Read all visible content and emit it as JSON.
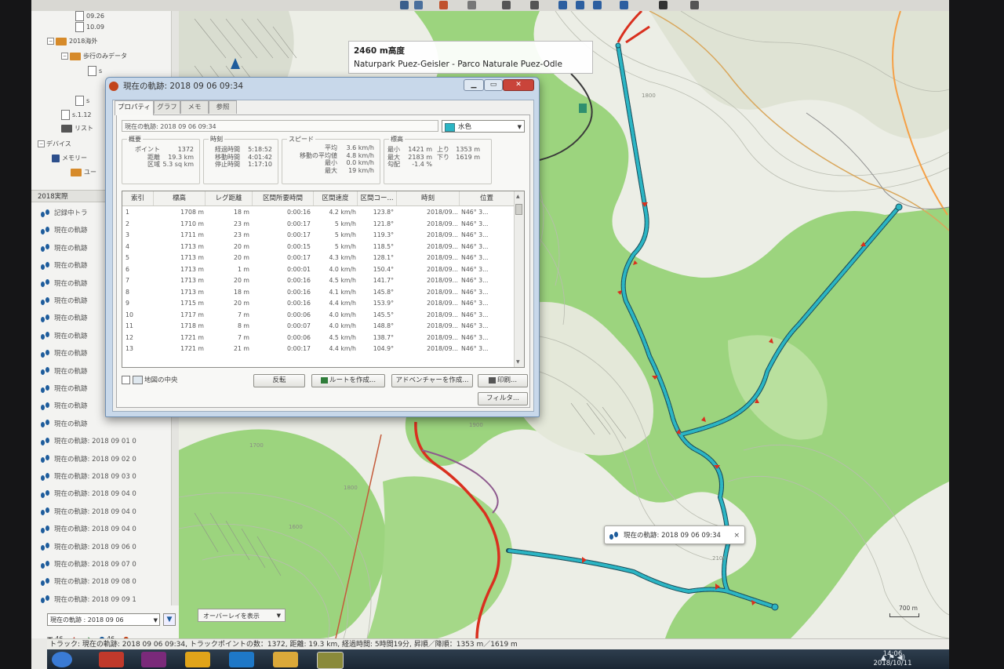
{
  "window": {
    "dialog_title": "現在の軌跡: 2018 09 06 09:34",
    "tabs": [
      "プロパティ",
      "グラフ",
      "メモ",
      "参照"
    ]
  },
  "sidebar": {
    "tree": [
      {
        "label": "09.26"
      },
      {
        "label": "10.09"
      },
      {
        "label": "2018海外"
      },
      {
        "label": "歩行のみデータ"
      },
      {
        "label": "s"
      },
      {
        "label": "s"
      },
      {
        "label": "s.1.12"
      },
      {
        "label": "リスト"
      },
      {
        "label": "デバイス"
      },
      {
        "label": "メモリー"
      },
      {
        "label": "ユー"
      }
    ],
    "section_title": "2018実際",
    "tracks": [
      {
        "label": "記録中トラ"
      },
      {
        "label": "現在の軌跡"
      },
      {
        "label": "現在の軌跡"
      },
      {
        "label": "現在の軌跡"
      },
      {
        "label": "現在の軌跡"
      },
      {
        "label": "現在の軌跡"
      },
      {
        "label": "現在の軌跡"
      },
      {
        "label": "現在の軌跡"
      },
      {
        "label": "現在の軌跡"
      },
      {
        "label": "現在の軌跡"
      },
      {
        "label": "現在の軌跡"
      },
      {
        "label": "現在の軌跡"
      },
      {
        "label": "現在の軌跡"
      },
      {
        "label": "現在の軌跡: 2018 09 01 0"
      },
      {
        "label": "現在の軌跡: 2018 09 02 0"
      },
      {
        "label": "現在の軌跡: 2018 09 03 0"
      },
      {
        "label": "現在の軌跡: 2018 09 04 0"
      },
      {
        "label": "現在の軌跡: 2018 09 04 0"
      },
      {
        "label": "現在の軌跡: 2018 09 04 0"
      },
      {
        "label": "現在の軌跡: 2018 09 06 0"
      },
      {
        "label": "現在の軌跡: 2018 09 07 0"
      },
      {
        "label": "現在の軌跡: 2018 09 08 0"
      },
      {
        "label": "現在の軌跡: 2018 09 09 1"
      }
    ],
    "selected_track": "現在の軌跡 : 2018 09 06",
    "bottom_count_a": "46",
    "bottom_count_b": "46"
  },
  "map": {
    "tooltip_altitude": "2460 m高度",
    "tooltip_name": "Naturpark Puez-Geisler - Parco Naturale Puez-Odle",
    "overlay_button": "オーバーレイを表示",
    "popup_label": "現在の軌跡: 2018 09 06 09:34",
    "popup_close": "×",
    "scale_label": "700 m",
    "contour_labels": [
      "1700",
      "1800",
      "1900",
      "1600",
      "2100",
      "1800"
    ]
  },
  "properties": {
    "name_value": "現在の軌跡: 2018 09 06 09:34",
    "color_value": "水色",
    "summary": {
      "title": "概要",
      "rows": [
        {
          "k": "ポイント",
          "v": "1372"
        },
        {
          "k": "距離",
          "v": "19.3 km"
        },
        {
          "k": "区域",
          "v": "5.3 sq km"
        }
      ]
    },
    "time": {
      "title": "時刻",
      "rows": [
        {
          "k": "経過時間",
          "v": "5:18:52"
        },
        {
          "k": "移動時間",
          "v": "4:01:42"
        },
        {
          "k": "停止時間",
          "v": "1:17:10"
        }
      ]
    },
    "speed": {
      "title": "スピード",
      "rows": [
        {
          "k": "平均",
          "v": "3.6 km/h"
        },
        {
          "k": "移動の平均値",
          "v": "4.8 km/h"
        },
        {
          "k": "最小",
          "v": "0.0 km/h"
        },
        {
          "k": "最大",
          "v": "19 km/h"
        }
      ]
    },
    "elevation": {
      "title": "標高",
      "rows": [
        {
          "k": "最小",
          "v": "1421 m",
          "k2": "上り",
          "v2": "1353 m"
        },
        {
          "k": "最大",
          "v": "2183 m",
          "k2": "下り",
          "v2": "1619 m"
        },
        {
          "k": "勾配",
          "v": "-1.4 %",
          "k2": "",
          "v2": ""
        }
      ]
    },
    "table": {
      "headers": [
        "索引",
        "標高",
        "レグ距離",
        "区間所要時間",
        "区間速度",
        "区間コー...",
        "時刻",
        "位置"
      ],
      "rows": [
        [
          "1",
          "1708 m",
          "18 m",
          "0:00:16",
          "4.2 km/h",
          "123.8°",
          "2018/09...",
          "N46° 3..."
        ],
        [
          "2",
          "1710 m",
          "23 m",
          "0:00:17",
          "5 km/h",
          "121.8°",
          "2018/09...",
          "N46° 3..."
        ],
        [
          "3",
          "1711 m",
          "23 m",
          "0:00:17",
          "5 km/h",
          "119.3°",
          "2018/09...",
          "N46° 3..."
        ],
        [
          "4",
          "1713 m",
          "20 m",
          "0:00:15",
          "5 km/h",
          "118.5°",
          "2018/09...",
          "N46° 3..."
        ],
        [
          "5",
          "1713 m",
          "20 m",
          "0:00:17",
          "4.3 km/h",
          "128.1°",
          "2018/09...",
          "N46° 3..."
        ],
        [
          "6",
          "1713 m",
          "1 m",
          "0:00:01",
          "4.0 km/h",
          "150.4°",
          "2018/09...",
          "N46° 3..."
        ],
        [
          "7",
          "1713 m",
          "20 m",
          "0:00:16",
          "4.5 km/h",
          "141.7°",
          "2018/09...",
          "N46° 3..."
        ],
        [
          "8",
          "1713 m",
          "18 m",
          "0:00:16",
          "4.1 km/h",
          "145.8°",
          "2018/09...",
          "N46° 3..."
        ],
        [
          "9",
          "1715 m",
          "20 m",
          "0:00:16",
          "4.4 km/h",
          "153.9°",
          "2018/09...",
          "N46° 3..."
        ],
        [
          "10",
          "1717 m",
          "7 m",
          "0:00:06",
          "4.0 km/h",
          "145.5°",
          "2018/09...",
          "N46° 3..."
        ],
        [
          "11",
          "1718 m",
          "8 m",
          "0:00:07",
          "4.0 km/h",
          "148.8°",
          "2018/09...",
          "N46° 3..."
        ],
        [
          "12",
          "1721 m",
          "7 m",
          "0:00:06",
          "4.5 km/h",
          "138.7°",
          "2018/09...",
          "N46° 3..."
        ],
        [
          "13",
          "1721 m",
          "21 m",
          "0:00:17",
          "4.4 km/h",
          "104.9°",
          "2018/09...",
          "N46° 3..."
        ]
      ]
    },
    "center_map_label": "地図の中央",
    "buttons": {
      "reverse": "反転",
      "create_route": "ルートを作成...",
      "create_adventure": "アドベンチャーを作成...",
      "print": "印刷...",
      "filter": "フィルタ..."
    }
  },
  "statusbar": {
    "text": "トラック: 現在の軌跡: 2018 09 06 09:34, トラックポイントの数：1372, 距離: 19.3 km, 経過時間: 5時間19分, 昇順／降順：1353 m／1619 m"
  },
  "taskbar": {
    "time": "14:06",
    "date": "2018/10/11"
  },
  "colors": {
    "track": "#2bb5c4",
    "route_red": "#d9301f",
    "forest": "#8ecf72",
    "meadow": "#e9ecd9"
  }
}
